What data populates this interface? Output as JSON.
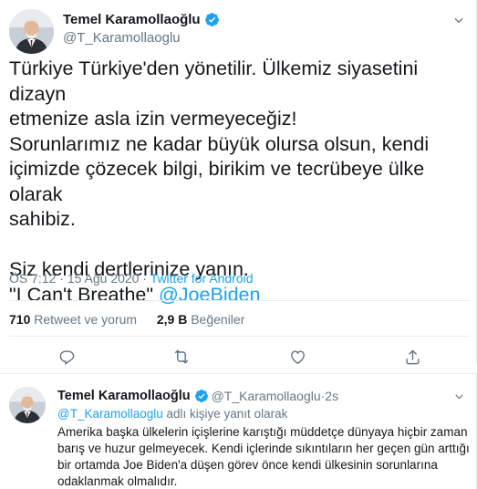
{
  "tweet": {
    "author": {
      "display_name": "Temel Karamollaoğlu",
      "handle": "@T_Karamollaoglu",
      "avatar_icon": "profile-photo",
      "verified_icon": "verified-badge-icon"
    },
    "text_lines": [
      "Türkiye Türkiye'den yönetilir. Ülkemiz siyasetini dizayn",
      "etmenize asla izin vermeyeceğiz!",
      "Sorunlarımız ne kadar büyük olursa olsun, kendi",
      "içimizde çözecek bilgi, birikim ve tecrübeye ülke olarak",
      "sahibiz.",
      "",
      "Siz kendi dertlerinize yanın.",
      "\"I Can't Breathe\" "
    ],
    "mention": "@JoeBiden",
    "time": "ÖS 7:12",
    "date_separator": " · ",
    "date": "15 Ağu 2020",
    "source": "Twitter for Android",
    "stats": {
      "retweets_count": "710",
      "retweets_label": " Retweet ve yorum",
      "likes_count": "2,9 B",
      "likes_label": " Beğeniler"
    },
    "actions": {
      "reply_icon": "reply-icon",
      "retweet_icon": "retweet-icon",
      "like_icon": "heart-icon",
      "share_icon": "share-icon"
    }
  },
  "reply": {
    "author": {
      "display_name": "Temel Karamollaoğlu",
      "handle": "@T_Karamollaoglu",
      "time_separator": " · ",
      "time": "2s"
    },
    "replying_to_mention": "@T_Karamollaoglu",
    "replying_to_suffix": " adlı kişiye yanıt olarak",
    "text": "Amerika başka ülkelerin içişlerine karıştığı müddetçe dünyaya hiçbir zaman barış ve huzur gelmeyecek. Kendi içlerinde sıkıntıların her geçen gün arttığı bir ortamda Joe Biden'a düşen görev önce kendi ülkesinin sorunlarına odaklanmak olmalıdır."
  },
  "colors": {
    "accent": "#1da1f2",
    "secondary_text": "#657786",
    "primary_text": "#14171a",
    "divider": "#e6ecf0"
  }
}
